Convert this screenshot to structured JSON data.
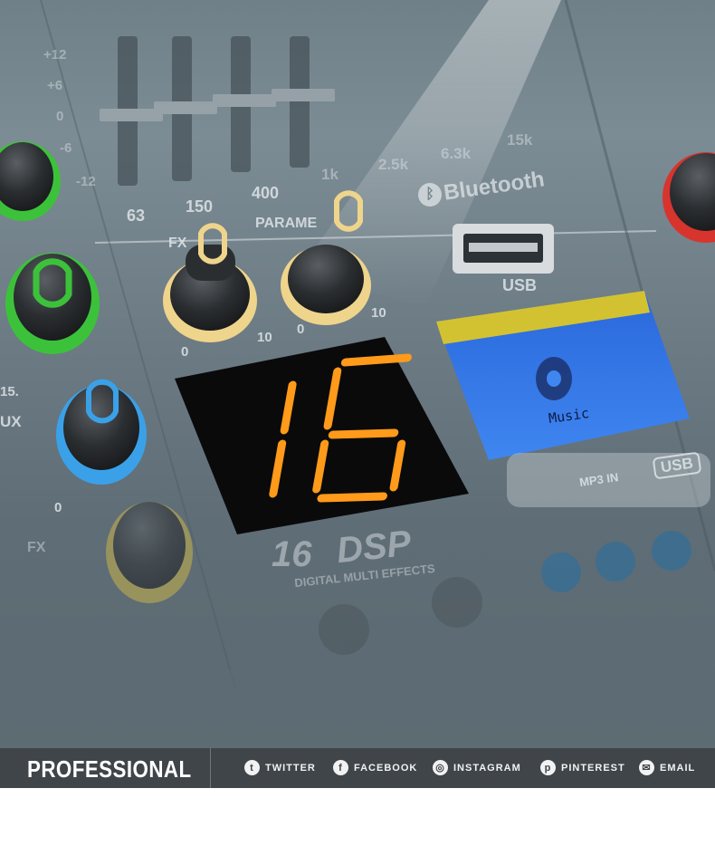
{
  "display": {
    "value": "16"
  },
  "eq": {
    "scale": [
      "+12",
      "+6",
      "0",
      "-6",
      "-12"
    ],
    "freqs": [
      "63",
      "150",
      "400",
      "1k",
      "2.5k",
      "6.3k",
      "15k"
    ]
  },
  "labels": {
    "fx": "FX",
    "param": "PARAME",
    "aux": "UX",
    "fx2": "FX",
    "bluetooth": "Bluetooth",
    "usb": "USB",
    "mp3in": "MP3 IN",
    "usb_badge": "USB",
    "lcd_text": "Music",
    "knob_min": "0",
    "knob_max": "10",
    "fifteen": "15."
  },
  "dsp": {
    "num": "16",
    "word": "DSP",
    "subtitle": "DIGITAL MULTI EFFECTS"
  },
  "footer": {
    "brand": "PROFESSIONAL",
    "links": [
      {
        "label": "TWITTER",
        "icon": "twitter-icon"
      },
      {
        "label": "FACEBOOK",
        "icon": "facebook-icon"
      },
      {
        "label": "INSTAGRAM",
        "icon": "instagram-icon"
      },
      {
        "label": "PINTEREST",
        "icon": "pinterest-icon"
      },
      {
        "label": "EMAIL",
        "icon": "email-icon"
      }
    ]
  },
  "colors": {
    "segment": "#ff9a1a",
    "lcd_blue": "#2f6fe0",
    "lcd_yellow": "#d2c232",
    "panel": "#6f8088",
    "footer": "#3f4549"
  }
}
